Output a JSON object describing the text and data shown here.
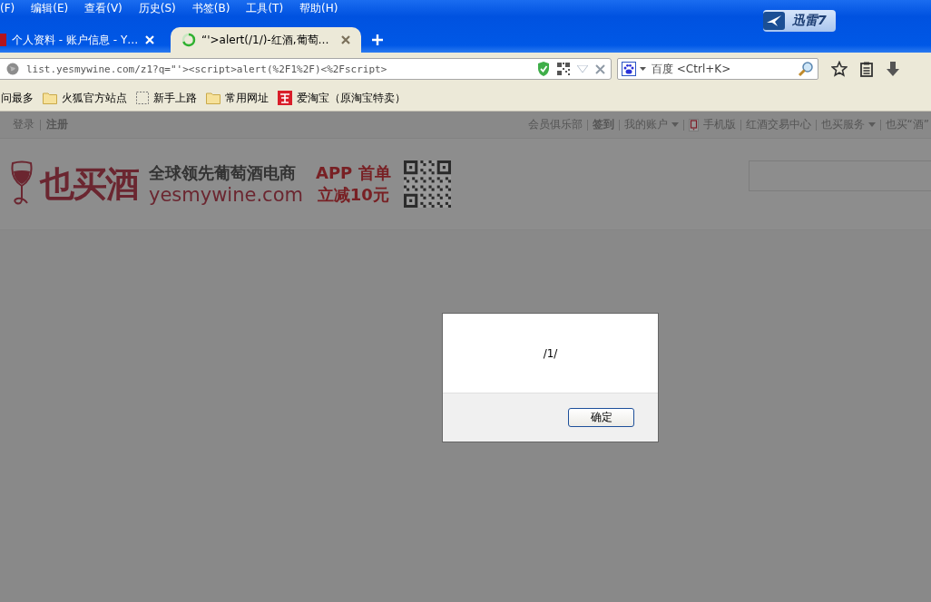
{
  "menu_bar": [
    "(F)",
    "编辑(E)",
    "查看(V)",
    "历史(S)",
    "书签(B)",
    "工具(T)",
    "帮助(H)"
  ],
  "xunlei_badge": {
    "label": "迅雷7"
  },
  "tabs": [
    {
      "label": "个人资料 - 账户信息 - Y…",
      "selected": false,
      "kind": "favicon"
    },
    {
      "label": "“'>alert(/1/)-红酒,葡萄…",
      "selected": true,
      "kind": "loading"
    }
  ],
  "address_bar": {
    "value": "list.yesmywine.com/z1?q=\"'><script>alert(%2F1%2F)<%2Fscript>"
  },
  "search_box": {
    "placeholder": "百度 <Ctrl+K>"
  },
  "bookmarks": [
    {
      "label": "问最多",
      "kind": "none"
    },
    {
      "label": "火狐官方站点",
      "kind": "folder"
    },
    {
      "label": "新手上路",
      "kind": "dashed"
    },
    {
      "label": "常用网址",
      "kind": "folder"
    },
    {
      "label": "爱淘宝（原淘宝特卖）",
      "kind": "shop"
    }
  ],
  "site": {
    "left_links": [
      {
        "label": "登录",
        "bold": false
      },
      {
        "label": "注册",
        "bold": true
      }
    ],
    "right_links": [
      {
        "label": "会员俱乐部",
        "bold": false,
        "dropdown": false,
        "kind": "plain"
      },
      {
        "label": "签到",
        "bold": true,
        "dropdown": false,
        "kind": "plain"
      },
      {
        "label": "我的账户",
        "bold": false,
        "dropdown": true,
        "kind": "plain"
      },
      {
        "label": "手机版",
        "bold": false,
        "dropdown": false,
        "kind": "phone"
      },
      {
        "label": "红酒交易中心",
        "bold": false,
        "dropdown": false,
        "kind": "plain"
      },
      {
        "label": "也买服务",
        "bold": false,
        "dropdown": true,
        "kind": "plain"
      },
      {
        "label": "也买“酒”",
        "bold": false,
        "dropdown": false,
        "kind": "plain"
      }
    ],
    "logo": {
      "name": "也买酒",
      "slogan": "全球领先葡萄酒电商",
      "domain": "yesmywine.com",
      "promo_line_1": "APP 首单",
      "promo_line_2": "立减10元"
    }
  },
  "dialog": {
    "message": "/1/",
    "button": "确定"
  }
}
